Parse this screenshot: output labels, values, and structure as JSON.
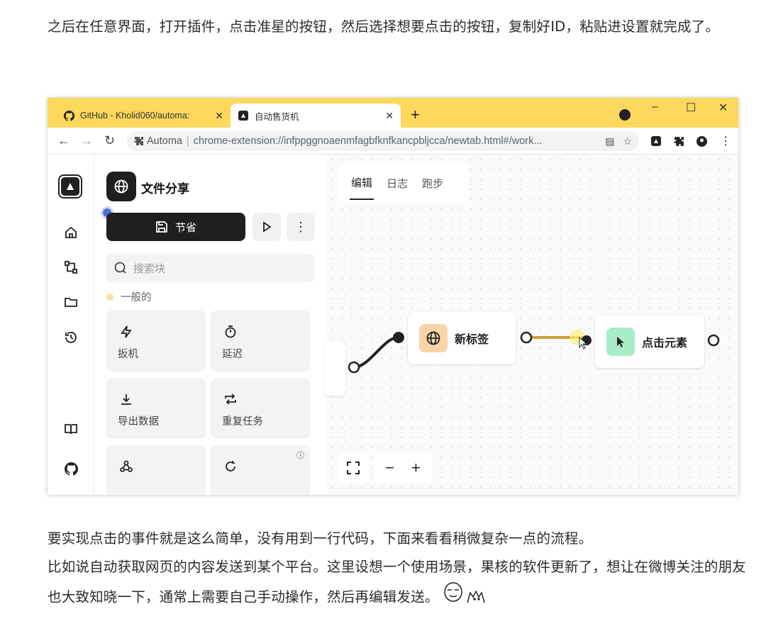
{
  "article": {
    "para1": "之后在任意界面，打开插件，点击准星的按钮，然后选择想要点击的按钮，复制好ID，粘贴进设置就完成了。",
    "para2_line1": "要实现点击的事件就是这么简单，没有用到一行代码，下面来看看稍微复杂一点的流程。",
    "para2_line2": "比如说自动获取网页的内容发送到某个平台。这里设想一个使用场景，果核的软件更新了，想让在微博关注的朋友也大致知晓一下，通常上需要自己手动操作，然后再编辑发送。"
  },
  "browser": {
    "tabs": [
      {
        "title": "GitHub - Kholid060/automa: ",
        "icon": "github-icon"
      },
      {
        "title": "自动售货机",
        "icon": "automa-icon"
      }
    ],
    "new_tab": "+",
    "window_controls": {
      "minimize": "–",
      "maximize": "☐",
      "close": "✕"
    },
    "address": {
      "ext_name": "Automa",
      "url": "chrome-extension://infppggnoaenmfagbfknfkancpbljcca/newtab.html#/work..."
    }
  },
  "app": {
    "workflow_title": "文件分享",
    "save_label": "节省",
    "search_placeholder": "搜索块",
    "category": "一般的",
    "blocks": [
      {
        "label": "扳机",
        "icon": "lightning-icon"
      },
      {
        "label": "延迟",
        "icon": "timer-icon"
      },
      {
        "label": "导出数据",
        "icon": "download-icon"
      },
      {
        "label": "重复任务",
        "icon": "repeat-icon"
      },
      {
        "label": "",
        "icon": "webhook-icon"
      },
      {
        "label": "",
        "icon": "loop-icon"
      }
    ],
    "editor_tabs": [
      "编辑",
      "日志",
      "跑步"
    ],
    "nodes": [
      {
        "label": "新标签",
        "icon": "globe-icon",
        "color": "#fbd3a8"
      },
      {
        "label": "点击元素",
        "icon": "cursor-icon",
        "color": "#a8ecc8"
      }
    ],
    "zoom": {
      "out": "−",
      "in": "+"
    }
  }
}
